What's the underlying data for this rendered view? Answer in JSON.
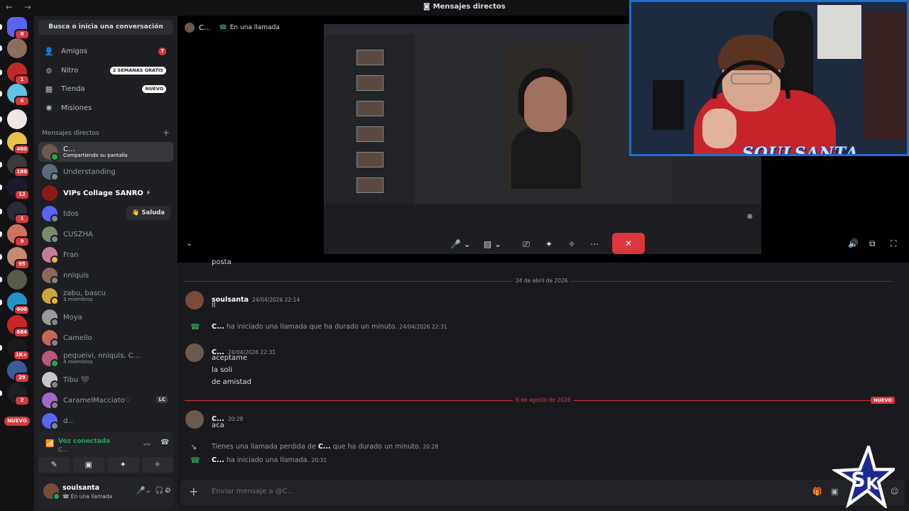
{
  "window": {
    "title": "Mensajes directos",
    "nav_arrows": "← →"
  },
  "servers": [
    {
      "name": "discord-home",
      "badge": "8",
      "color": "#5865f2"
    },
    {
      "name": "server-1",
      "badge": "",
      "color": "#8a6f5c"
    },
    {
      "name": "server-2",
      "badge": "1",
      "color": "#c22a2a"
    },
    {
      "name": "server-3",
      "badge": "6",
      "color": "#5fc3e4"
    },
    {
      "name": "server-4",
      "badge": "",
      "color": "#f0e6e6"
    },
    {
      "name": "server-5",
      "badge": "480",
      "color": "#e8c24a"
    },
    {
      "name": "server-6",
      "badge": "180",
      "color": "#3a3a3a"
    },
    {
      "name": "server-7",
      "badge": "12",
      "color": "#1b1b2e"
    },
    {
      "name": "server-8",
      "badge": "1",
      "color": "#2a2a3a"
    },
    {
      "name": "server-9",
      "badge": "9",
      "color": "#d0735e"
    },
    {
      "name": "server-10",
      "badge": "95",
      "color": "#c48a6e"
    },
    {
      "name": "server-11",
      "badge": "",
      "color": "#5a5a4a"
    },
    {
      "name": "server-12",
      "badge": "600",
      "color": "#2494c8"
    },
    {
      "name": "server-13",
      "badge": "684",
      "color": "#c8252a"
    },
    {
      "name": "server-14",
      "badge": "1K+",
      "color": "#1a1a1a"
    },
    {
      "name": "server-15",
      "badge": "29",
      "color": "#3a5a9a"
    },
    {
      "name": "server-16",
      "badge": "2",
      "color": "#1e1f22"
    }
  ],
  "rail_new": "NUEVO",
  "sidebar": {
    "search": "Busca o inicia una conversación",
    "nav": [
      {
        "label": "Amigos",
        "icon": "👤",
        "badge": "7"
      },
      {
        "label": "Nitro",
        "icon": "⊚",
        "badge": "2 SEMANAS GRATIS"
      },
      {
        "label": "Tienda",
        "icon": "▦",
        "badge": "NUEVO"
      },
      {
        "label": "Misiones",
        "icon": "✺",
        "badge": ""
      }
    ],
    "dm_header": "Mensajes directos",
    "dm_plus": "+",
    "dms": [
      {
        "name": "C...",
        "sub": "Compartiendo su pantalla"
      },
      {
        "name": "Understanding",
        "sub": ""
      },
      {
        "name": "VIPs Collage SANRO ⚡",
        "sub": ""
      },
      {
        "name": "tdos",
        "sub": "",
        "action": "👋 Saluda"
      },
      {
        "name": "CUSZHA",
        "sub": ""
      },
      {
        "name": "Fran",
        "sub": ""
      },
      {
        "name": "nniquis",
        "sub": ""
      },
      {
        "name": "zabu, bascu",
        "sub": "3 miembros"
      },
      {
        "name": "Moya",
        "sub": ""
      },
      {
        "name": "Camello",
        "sub": ""
      },
      {
        "name": "pequeivi, nniquis, C...",
        "sub": "4 miembros"
      },
      {
        "name": "Tibu 🖤",
        "sub": ""
      },
      {
        "name": "CaramelMacciato♡",
        "sub": "",
        "tag": "LC"
      },
      {
        "name": "d...",
        "sub": ""
      }
    ]
  },
  "voice": {
    "title": "Voz conectada",
    "channel": "C...",
    "buttons": [
      "✎",
      "▣",
      "✦",
      "✧"
    ]
  },
  "user": {
    "name": "soulsanta",
    "status": "En una llamada"
  },
  "call": {
    "user": "C...",
    "status": "En una llamada",
    "controls": [
      "🎤",
      "⌄",
      "▨",
      "⌄",
      "⎚",
      "✦",
      "✧",
      "⋯"
    ],
    "end_icon": "✕",
    "right_icons": [
      "🔊",
      "⧉",
      "⛶"
    ],
    "collapse": "⌄",
    "zoom": "⊕"
  },
  "chat": {
    "partial": "posta",
    "date1": "24 de abril de 2026",
    "m1": {
      "name": "soulsanta",
      "time": "24/04/2026 22:14",
      "lines": [
        "ll"
      ]
    },
    "sys1": {
      "who": "C...",
      "text": "ha iniciado una llamada que ha durado un minuto.",
      "time": "24/04/2026 22:31"
    },
    "m2": {
      "name": "C...",
      "time": "24/04/2026 22:31",
      "lines": [
        "aceptame",
        "la soli",
        "de amistad"
      ]
    },
    "date2": "6 de agosto de 2026",
    "new_tag": "NUEVO",
    "m3": {
      "name": "C...",
      "time": "20:28",
      "lines": [
        "aca"
      ]
    },
    "sys2": {
      "prefix": "Tienes una llamada perdida de",
      "who": "C...",
      "text": "que ha durado un minuto.",
      "time": "20:28"
    },
    "sys3": {
      "who": "C...",
      "text": "ha iniciado una llamada.",
      "time": "20:31"
    }
  },
  "composer": {
    "placeholder": "Enviar mensaje a @C...",
    "plus": "+"
  },
  "overlay": {
    "streamer_logo": "SOULSANTA"
  }
}
